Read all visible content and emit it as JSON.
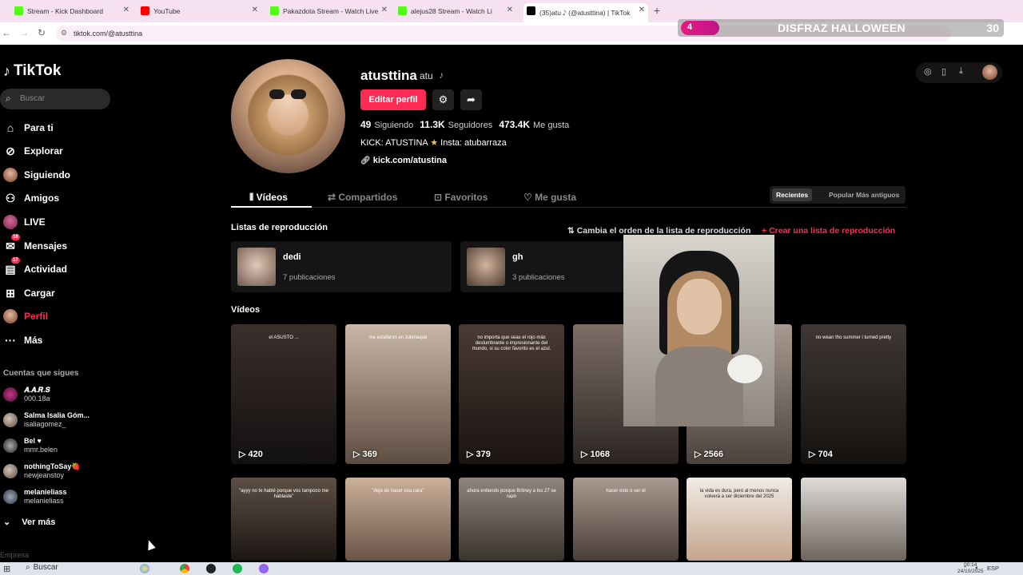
{
  "browser": {
    "tabs": [
      {
        "title": "Stream - Kick Dashboard",
        "favicon_color": "#53fc18"
      },
      {
        "title": "YouTube",
        "favicon_color": "#ff0000"
      },
      {
        "title": "Pakazdota Stream - Watch Live",
        "favicon_color": "#53fc18"
      },
      {
        "title": "alejus28 Stream - Watch Li",
        "favicon_color": "#53fc18"
      },
      {
        "title": "(35)atu 𝅘𝅥𝅮 (@atusttina) | TikTok",
        "favicon_color": "#000000"
      }
    ],
    "url": "tiktok.com/@atusttina"
  },
  "banner": {
    "badge": "4",
    "title": "DISFRAZ HALLOWEEN",
    "count": "30"
  },
  "sidebar": {
    "logo": "TikTok",
    "search_placeholder": "Buscar",
    "nav": [
      {
        "label": "Para ti",
        "icon": "home-icon"
      },
      {
        "label": "Explorar",
        "icon": "compass-icon"
      },
      {
        "label": "Siguiendo",
        "icon": "following-icon"
      },
      {
        "label": "Amigos",
        "icon": "friends-icon"
      },
      {
        "label": "LIVE",
        "icon": "live-icon"
      },
      {
        "label": "Mensajes",
        "icon": "messages-icon",
        "badge": "18"
      },
      {
        "label": "Actividad",
        "icon": "activity-icon",
        "badge": "17"
      },
      {
        "label": "Cargar",
        "icon": "upload-icon"
      },
      {
        "label": "Perfil",
        "icon": "profile-icon"
      },
      {
        "label": "Más",
        "icon": "more-icon"
      }
    ],
    "following_title": "Cuentas que sigues",
    "following": [
      {
        "name": "𝑨.𝑨.𝑹.𝑺",
        "handle": "000.18a"
      },
      {
        "name": "Salma Isalia Góm...",
        "handle": "isaliagomez_"
      },
      {
        "name": "Bel ♥",
        "handle": "mmr.belen"
      },
      {
        "name": "nothingToSay🍓",
        "handle": "newjeanstoy"
      },
      {
        "name": "melanieliass",
        "handle": "melanieliass"
      }
    ],
    "see_more": "Ver más",
    "footer": "Empresa"
  },
  "profile": {
    "username": "atusttina",
    "nickname": "atu",
    "edit_button": "Editar perfil",
    "following_count": "49",
    "following_label": "Siguiendo",
    "followers_count": "11.3K",
    "followers_label": "Seguidores",
    "likes_count": "473.4K",
    "likes_label": "Me gusta",
    "bio_part1": "KICK: ATUSTINA",
    "bio_star": "★",
    "bio_part2": "Insta: atubarraza",
    "link": "kick.com/atustina"
  },
  "tabs": {
    "videos": "Vídeos",
    "shared": "Compartidos",
    "favorites": "Favoritos",
    "liked": "Me gusta"
  },
  "sort": {
    "recent": "Recientes",
    "popular": "Popular",
    "oldest": "Más antiguos"
  },
  "playlists": {
    "title": "Listas de reproducción",
    "reorder": "Cambia el orden de la lista de reproducción",
    "create": "Crear una lista de reproducción",
    "items": [
      {
        "name": "dedi",
        "count": "7 publicaciones"
      },
      {
        "name": "gh",
        "count": "3 publicaciones"
      }
    ]
  },
  "videos": {
    "title": "Vídeos",
    "row1": [
      {
        "views": "420",
        "caption": "el ASUSTO ...",
        "color1": "#3b2f2b",
        "color2": "#121010"
      },
      {
        "views": "369",
        "caption": "me estafaron en Juleriaque",
        "color1": "#c8b6a5",
        "color2": "#5e4d42"
      },
      {
        "views": "379",
        "caption": "no importa que seas el rojo más deslumbrante o impresionante del mundo, si su color favorito es el azul.",
        "color1": "#4a3a33",
        "color2": "#1a1412"
      },
      {
        "views": "1068",
        "caption": "",
        "color1": "#7d6e66",
        "color2": "#2b2522"
      },
      {
        "views": "2566",
        "caption": "",
        "color1": "#a79a90",
        "color2": "#4c433d"
      },
      {
        "views": "704",
        "caption": "no wean tho summer i turned pretty",
        "color1": "#3f3835",
        "color2": "#141210"
      }
    ],
    "row2": [
      {
        "caption": "\"ayyy no te hablé porque vos tampoco me hablaste\"",
        "color1": "#5d4f45",
        "color2": "#1c1612"
      },
      {
        "caption": "\"deja de hacer esa cara\"",
        "color1": "#cbb09a",
        "color2": "#6a5446"
      },
      {
        "caption": "ahora entiendo porque Britney a los 27 se rapó",
        "color1": "#8e857d",
        "color2": "#3a342f"
      },
      {
        "caption": "hacer esto o ser él",
        "color1": "#a89a90",
        "color2": "#4a3f38"
      },
      {
        "caption": "la vida es dura, pero al menos nunca volverá a ser diciembre del 2025",
        "color1": "#f0ebe6",
        "color2": "#c6a58c"
      },
      {
        "caption": "",
        "color1": "#e0dcd8",
        "color2": "#6e655e"
      }
    ]
  },
  "taskbar": {
    "search": "Buscar",
    "lang": "ESP",
    "time": "00:14",
    "date": "24/10/2025"
  }
}
